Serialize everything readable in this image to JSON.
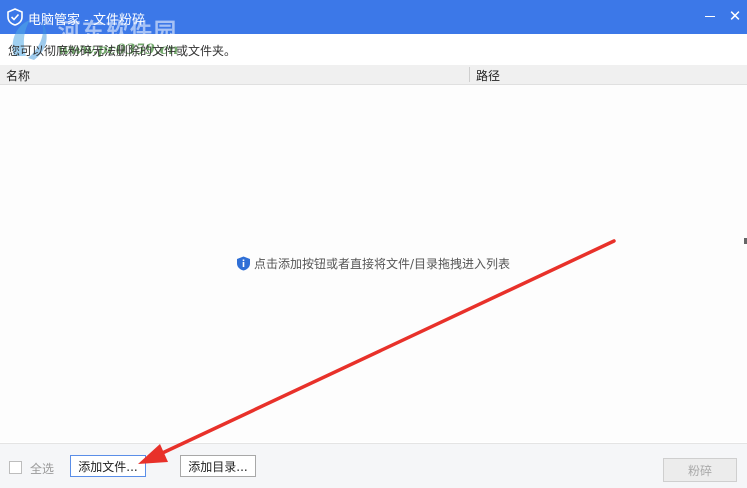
{
  "window": {
    "title": "电脑管家 - 文件粉碎",
    "minimize_icon": "minimize-icon",
    "close_icon": "close-icon",
    "close_glyph": "✕"
  },
  "watermark": {
    "title": "河东软件园",
    "url": "www.pc0359.cn"
  },
  "description": "您可以彻底粉碎无法删除的文件或文件夹。",
  "table": {
    "columns": [
      "名称",
      "路径"
    ],
    "rows": []
  },
  "empty_hint": {
    "icon": "info-icon",
    "text": "点击添加按钮或者直接将文件/目录拖拽进入列表"
  },
  "footer": {
    "select_all_label": "全选",
    "select_all_checked": false,
    "add_file_label": "添加文件...",
    "add_dir_label": "添加目录...",
    "shred_label": "粉碎",
    "shred_enabled": false
  },
  "annotation": {
    "arrow_color": "#e8312a"
  },
  "colors": {
    "titlebar": "#3c78e8",
    "accent": "#5a8ee8"
  }
}
